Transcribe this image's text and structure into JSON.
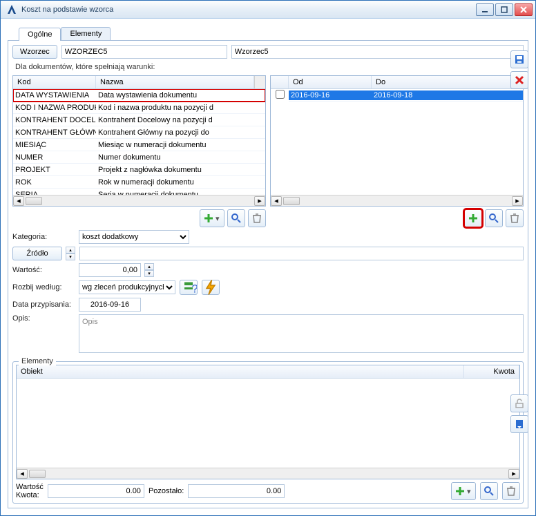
{
  "window": {
    "title": "Koszt na podstawie wzorca"
  },
  "tabs": [
    "Ogólne",
    "Elementy"
  ],
  "wzorzec": {
    "label": "Wzorzec",
    "code": "WZORZEC5",
    "name": "Wzorzec5"
  },
  "docFilterLabel": "Dla dokumentów, które spełniają warunki:",
  "leftGrid": {
    "headers": [
      "Kod",
      "Nazwa"
    ],
    "rows": [
      {
        "kod": "DATA WYSTAWIENIA",
        "nazwa": "Data wystawienia dokumentu",
        "hl": true
      },
      {
        "kod": "KOD I NAZWA PRODUKT",
        "nazwa": "Kod i nazwa produktu na pozycji d"
      },
      {
        "kod": "KONTRAHENT DOCELOW",
        "nazwa": "Kontrahent Docelowy na pozycji d"
      },
      {
        "kod": "KONTRAHENT GŁÓWNY",
        "nazwa": "Kontrahent Główny na pozycji do"
      },
      {
        "kod": "MIESIĄC",
        "nazwa": "Miesiąc w numeracji dokumentu"
      },
      {
        "kod": "NUMER",
        "nazwa": "Numer dokumentu"
      },
      {
        "kod": "PROJEKT",
        "nazwa": "Projekt z nagłówka dokumentu"
      },
      {
        "kod": "ROK",
        "nazwa": "Rok w numeracji dokumentu"
      },
      {
        "kod": "SERIA",
        "nazwa": "Seria w numeracji dokumentu"
      }
    ]
  },
  "rightGrid": {
    "headers": [
      "Od",
      "Do"
    ],
    "rows": [
      {
        "od": "2016-09-16",
        "do": "2016-09-18"
      }
    ]
  },
  "kategoria": {
    "label": "Kategoria:",
    "value": "koszt dodatkowy"
  },
  "zrodlo": {
    "label": "Źródło"
  },
  "wartosc": {
    "label": "Wartość:",
    "value": "0,00"
  },
  "rozbij": {
    "label": "Rozbij według:",
    "value": "wg zleceń produkcyjnych"
  },
  "dataPrzyp": {
    "label": "Data przypisania:",
    "value": "2016-09-16"
  },
  "opis": {
    "label": "Opis:",
    "placeholder": "Opis"
  },
  "elementy": {
    "title": "Elementy",
    "headers": [
      "Obiekt",
      "Kwota"
    ]
  },
  "footer": {
    "wartoscKwota": "Wartość\nKwota:",
    "wartoscLabel": "Wartość",
    "kwotaLabel": "Kwota:",
    "kwotaValue": "0.00",
    "pozostaloLabel": "Pozostało:",
    "pozostaloValue": "0.00"
  }
}
